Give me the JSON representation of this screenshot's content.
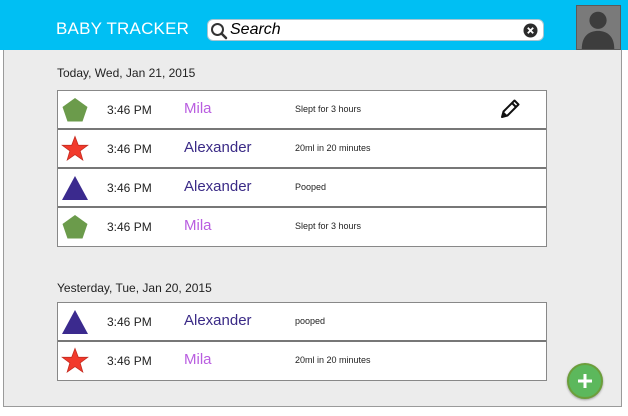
{
  "header": {
    "title": "BABY TRACKER",
    "search_placeholder": "Search",
    "search_value": "",
    "bg_color": "#00bff3"
  },
  "colors": {
    "mila": "#b95de0",
    "alexander": "#3a2a86",
    "pentagon": "#6b9b4b",
    "star": "#f23a2c",
    "triangle": "#3b2a8e",
    "fab": "#5cb85c"
  },
  "sections": [
    {
      "date": "Today, Wed, Jan 21, 2015",
      "entries": [
        {
          "icon": "pentagon-icon",
          "time": "3:46 PM",
          "name": "Mila",
          "description": "Slept for 3 hours",
          "editable": true
        },
        {
          "icon": "star-icon",
          "time": "3:46 PM",
          "name": "Alexander",
          "description": "20ml in 20 minutes"
        },
        {
          "icon": "triangle-icon",
          "time": "3:46 PM",
          "name": "Alexander",
          "description": "Pooped"
        },
        {
          "icon": "pentagon-icon",
          "time": "3:46 PM",
          "name": "Mila",
          "description": "Slept for 3 hours"
        }
      ]
    },
    {
      "date": "Yesterday, Tue, Jan 20, 2015",
      "entries": [
        {
          "icon": "triangle-icon",
          "time": "3:46 PM",
          "name": "Alexander",
          "description": "pooped"
        },
        {
          "icon": "star-icon",
          "time": "3:46 PM",
          "name": "Mila",
          "description": "20ml in 20 minutes"
        }
      ]
    }
  ],
  "icons": {
    "search": "search-icon",
    "clear": "clear-search-icon",
    "edit": "pencil-icon",
    "add": "plus-icon",
    "avatar": "user-silhouette-icon"
  }
}
